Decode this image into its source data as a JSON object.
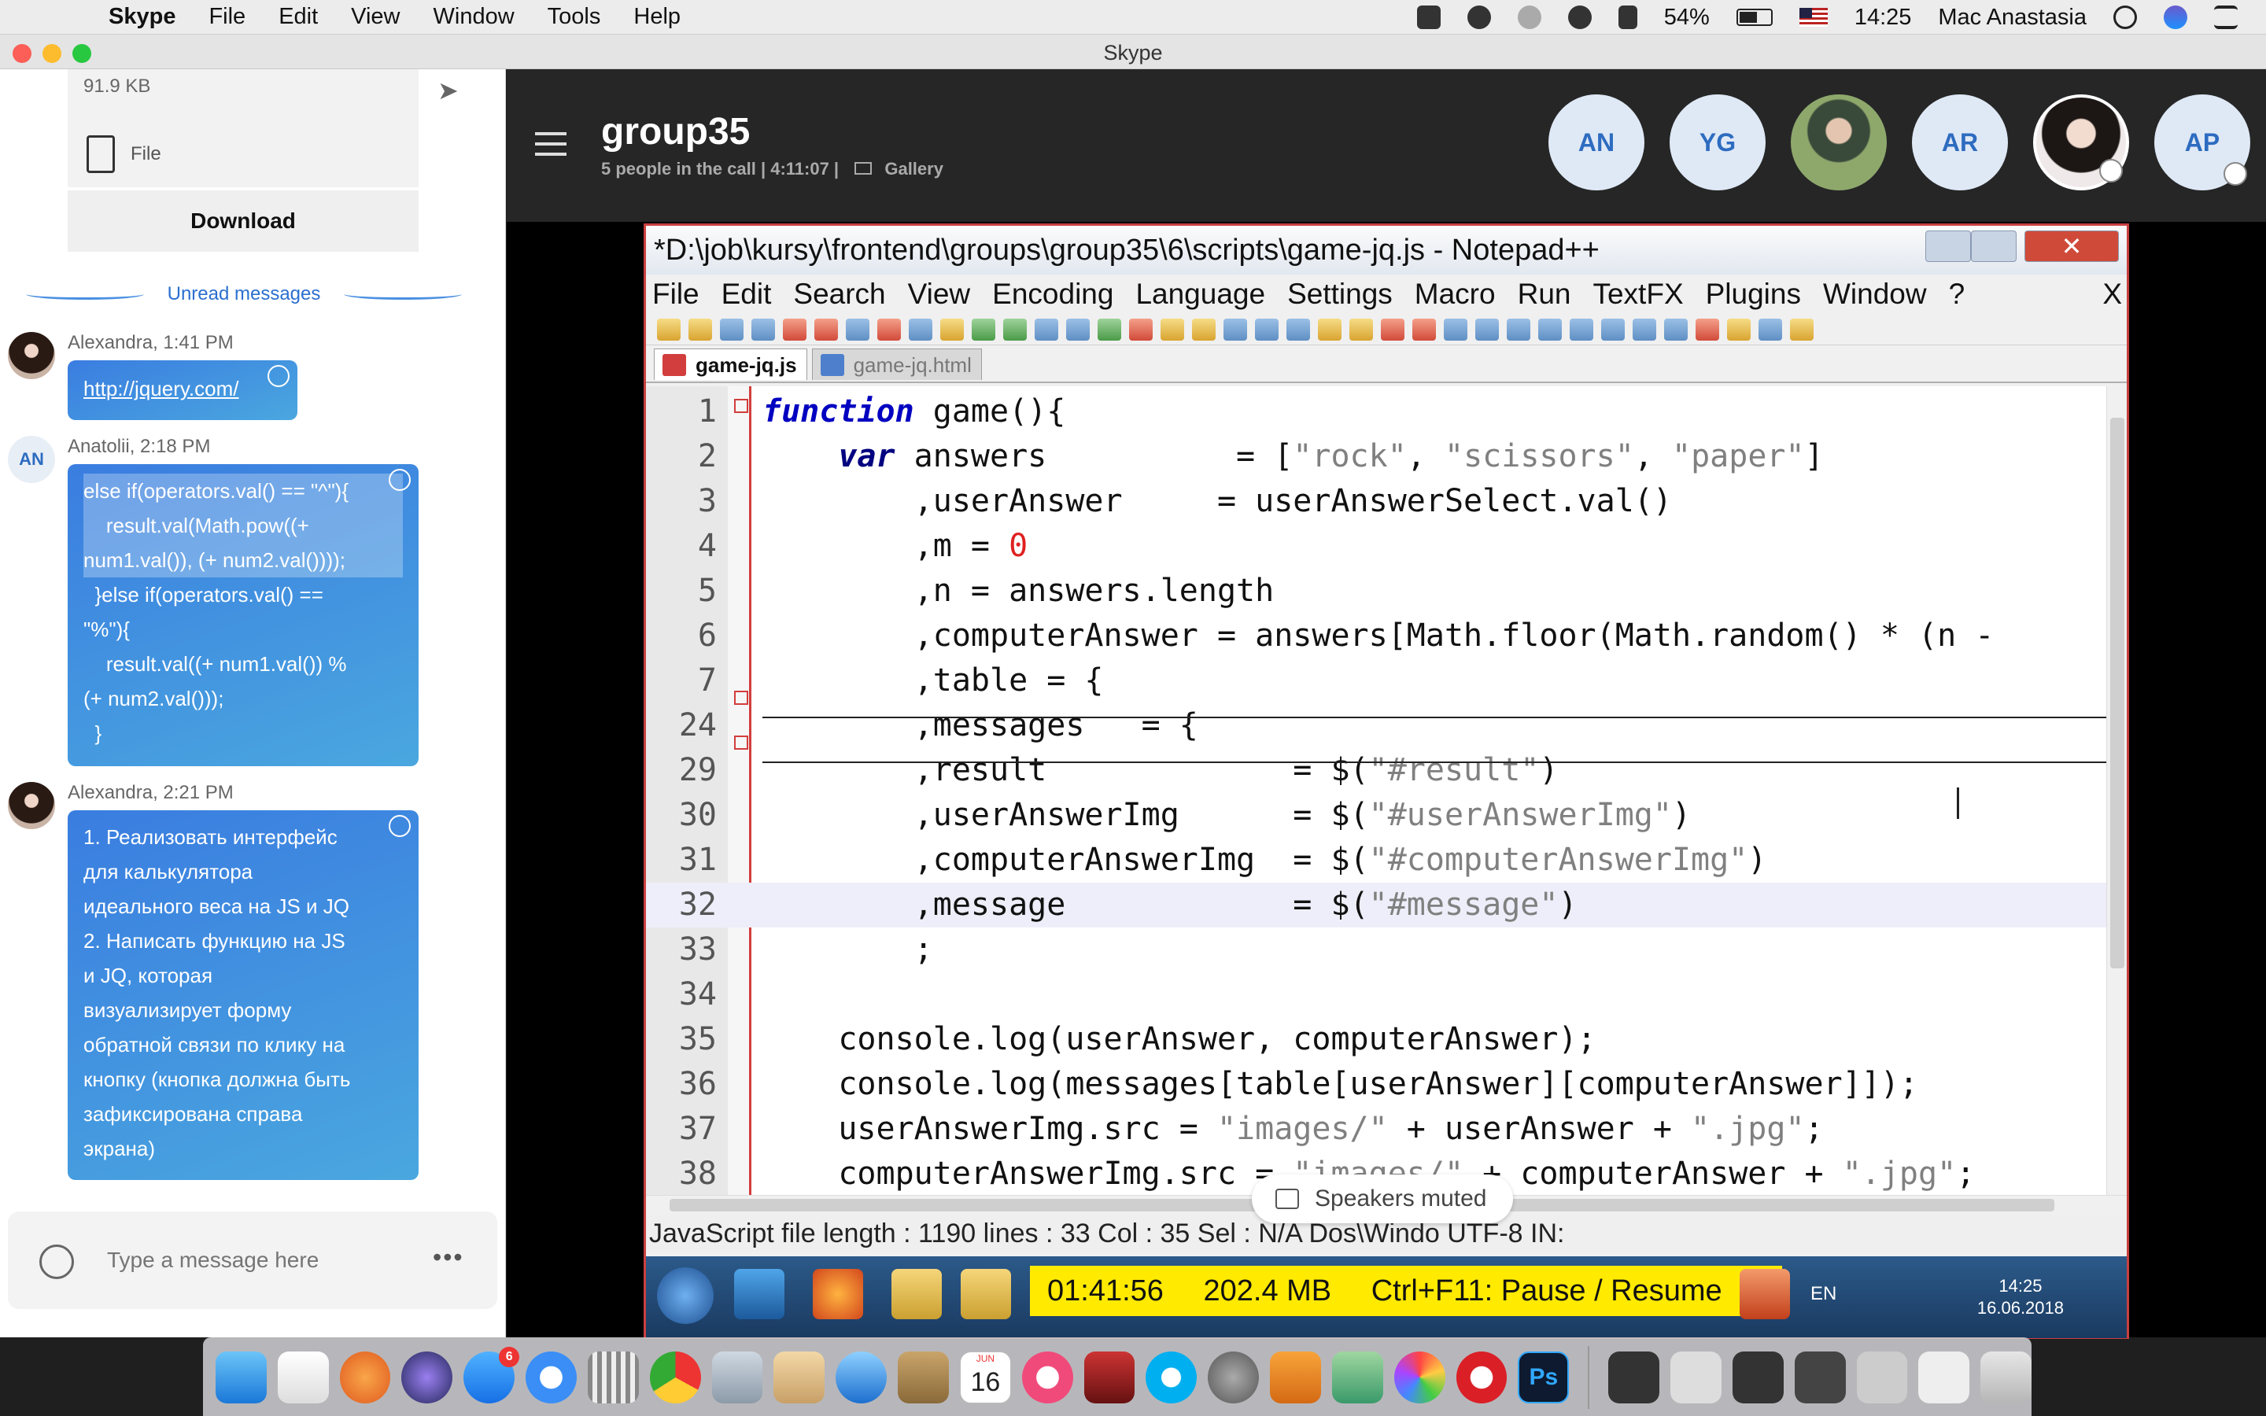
{
  "menubar": {
    "app_name": "Skype",
    "items": [
      "File",
      "Edit",
      "View",
      "Window",
      "Tools",
      "Help"
    ],
    "battery": "54%",
    "time": "14:25",
    "user": "Mac Anastasia"
  },
  "window": {
    "title": "Skype"
  },
  "chat": {
    "file": {
      "size": "91.9 KB",
      "label": "File",
      "download_label": "Download"
    },
    "unread_label": "Unread messages",
    "messages": [
      {
        "author_time": "Alexandra, 1:41 PM",
        "link": "http://jquery.com/"
      },
      {
        "author_initials": "AN",
        "author_time": "Anatolii, 2:18 PM",
        "lines": [
          "else if(operators.val() == \"^\"){",
          "    result.val(Math.pow((+",
          "num1.val()), (+ num2.val())));",
          "  }else if(operators.val() ==",
          "\"%\"){",
          "    result.val((+ num1.val()) %",
          "(+ num2.val()));",
          "  }"
        ]
      },
      {
        "author_time": "Alexandra, 2:21 PM",
        "lines": [
          "1. Реализовать интерфейс",
          "для калькулятора",
          "идеального веса на JS и JQ",
          "2. Написать функцию на JS",
          "и JQ, которая",
          "визуализирует форму",
          "обратной связи по клику на",
          "кнопку (кнопка должна быть",
          "зафиксирована справа",
          "экрана)"
        ]
      }
    ],
    "composer": {
      "placeholder": "Type a message here",
      "more": "•••"
    }
  },
  "call": {
    "title": "group35",
    "subtitle": "5 people in the call | 4:11:07  |",
    "gallery_label": "Gallery",
    "participants": [
      "AN",
      "YG",
      "",
      "AR",
      "",
      "AP"
    ],
    "speakers_muted": "Speakers muted"
  },
  "notepad": {
    "title": "*D:\\job\\kursy\\frontend\\groups\\group35\\6\\scripts\\game-jq.js - Notepad++",
    "menu": [
      "File",
      "Edit",
      "Search",
      "View",
      "Encoding",
      "Language",
      "Settings",
      "Macro",
      "Run",
      "TextFX",
      "Plugins",
      "Window",
      "?"
    ],
    "menu_close": "X",
    "close_glyph": "✕",
    "tabs": [
      "game-jq.js",
      "game-jq.html"
    ],
    "status": "JavaScript file          length : 1190    lines : 33    Col : 35    Sel : N/A    Dos\\Windo  UTF-8          IN:",
    "lines": [
      {
        "n": "1",
        "parts": [
          [
            "kw",
            "function"
          ],
          [
            "",
            " game(){"
          ]
        ]
      },
      {
        "n": "2",
        "parts": [
          [
            "",
            "    "
          ],
          [
            "kwv",
            "var"
          ],
          [
            "",
            " answers          = ["
          ],
          [
            "str",
            "\"rock\""
          ],
          [
            "",
            ", "
          ],
          [
            "str",
            "\"scissors\""
          ],
          [
            "",
            ", "
          ],
          [
            "str",
            "\"paper\""
          ],
          [
            "",
            "]"
          ]
        ]
      },
      {
        "n": "3",
        "parts": [
          [
            "",
            "        ,userAnswer     = userAnswerSelect.val()"
          ]
        ]
      },
      {
        "n": "4",
        "parts": [
          [
            "",
            "        ,m = "
          ],
          [
            "num",
            "0"
          ]
        ]
      },
      {
        "n": "5",
        "parts": [
          [
            "",
            "        ,n = answers.length"
          ]
        ]
      },
      {
        "n": "6",
        "parts": [
          [
            "",
            "        ,computerAnswer = answers[Math.floor(Math.random() * (n -"
          ]
        ]
      },
      {
        "n": "7",
        "parts": [
          [
            "",
            "        ,table = {"
          ]
        ]
      },
      {
        "n": "24",
        "parts": [
          [
            "",
            "        ,messages   = {"
          ]
        ]
      },
      {
        "n": "29",
        "parts": [
          [
            "",
            "        ,result             = $("
          ],
          [
            "str",
            "\"#result\""
          ],
          [
            "",
            ")"
          ]
        ]
      },
      {
        "n": "30",
        "parts": [
          [
            "",
            "        ,userAnswerImg      = $("
          ],
          [
            "str",
            "\"#userAnswerImg\""
          ],
          [
            "",
            ")"
          ]
        ]
      },
      {
        "n": "31",
        "parts": [
          [
            "",
            "        ,computerAnswerImg  = $("
          ],
          [
            "str",
            "\"#computerAnswerImg\""
          ],
          [
            "",
            ")"
          ]
        ]
      },
      {
        "n": "32",
        "parts": [
          [
            "",
            "        ,message            = $("
          ],
          [
            "str",
            "\"#message\""
          ],
          [
            "",
            ")"
          ]
        ]
      },
      {
        "n": "33",
        "parts": [
          [
            "",
            "        ;"
          ]
        ]
      },
      {
        "n": "34",
        "parts": [
          [
            "",
            ""
          ]
        ]
      },
      {
        "n": "35",
        "parts": [
          [
            "",
            "    console.log(userAnswer, computerAnswer);"
          ]
        ]
      },
      {
        "n": "36",
        "parts": [
          [
            "",
            "    console.log(messages[table[userAnswer][computerAnswer]]);"
          ]
        ]
      },
      {
        "n": "37",
        "parts": [
          [
            "",
            "    userAnswerImg.src = "
          ],
          [
            "str",
            "\"images/\""
          ],
          [
            "",
            " + userAnswer + "
          ],
          [
            "str",
            "\".jpg\""
          ],
          [
            "",
            ";"
          ]
        ]
      },
      {
        "n": "38",
        "parts": [
          [
            "",
            "    computerAnswerImg.src = "
          ],
          [
            "str",
            "\"images/\""
          ],
          [
            "",
            " + computerAnswer + "
          ],
          [
            "str",
            "\".jpg\""
          ],
          [
            "",
            ";"
          ]
        ]
      }
    ]
  },
  "taskbar": {
    "recorder": {
      "time": "01:41:56",
      "size": "202.4 MB",
      "hint": "Ctrl+F11: Pause / Resume"
    },
    "lang": "EN",
    "clock_time": "14:25",
    "clock_date": "16.06.2018"
  },
  "dock": {
    "calendar_day": "16",
    "calendar_month": "JUN",
    "appstore_badge": "6"
  },
  "colors": {
    "skype_blue": "#2b6fcf",
    "npp_border": "#c94040",
    "recorder_yellow": "#ffea00"
  }
}
